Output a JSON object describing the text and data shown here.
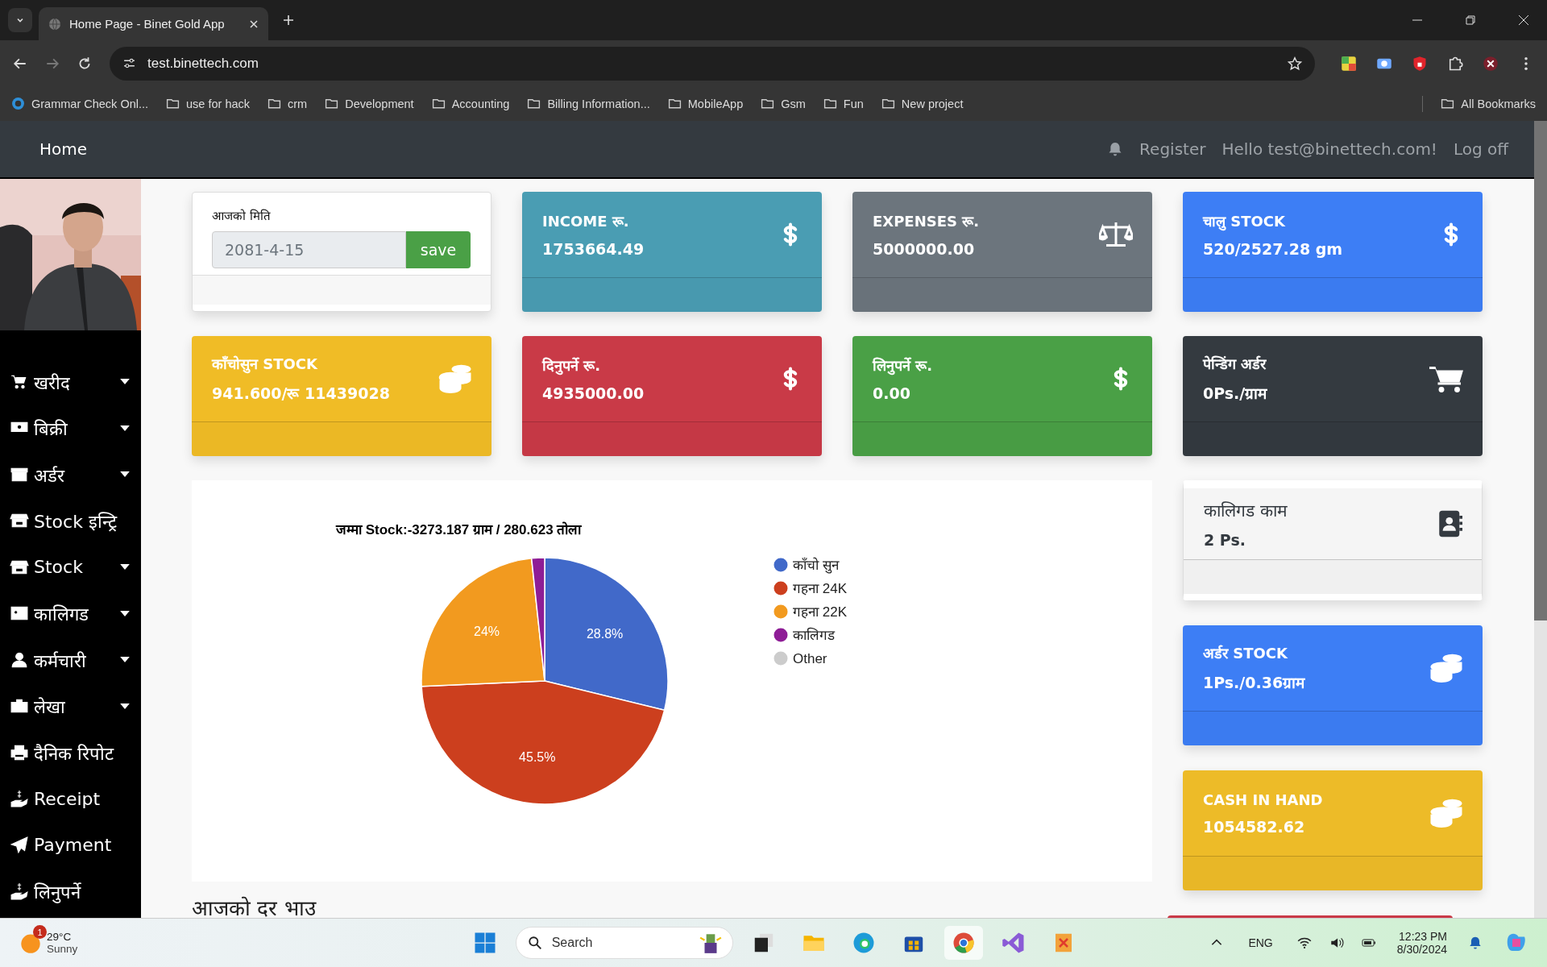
{
  "browser": {
    "tab_title": "Home Page - Binet Gold App",
    "url": "test.binettech.com",
    "bookmarks": [
      {
        "label": "Grammar Check Onl...",
        "kind": "site"
      },
      {
        "label": "use for hack",
        "kind": "folder"
      },
      {
        "label": "crm",
        "kind": "folder"
      },
      {
        "label": "Development",
        "kind": "folder"
      },
      {
        "label": "Accounting",
        "kind": "folder"
      },
      {
        "label": "Billing Information...",
        "kind": "folder"
      },
      {
        "label": "MobileApp",
        "kind": "folder"
      },
      {
        "label": "Gsm",
        "kind": "folder"
      },
      {
        "label": "Fun",
        "kind": "folder"
      },
      {
        "label": "New project",
        "kind": "folder"
      }
    ],
    "all_bookmarks": "All Bookmarks"
  },
  "navbar": {
    "brand": "Home",
    "links": [
      "Register",
      "Hello test@binettech.com!",
      "Log off"
    ]
  },
  "sidebar": {
    "items": [
      {
        "label": "खरीद",
        "kind": "dropdown"
      },
      {
        "label": "बिक्री",
        "kind": "dropdown"
      },
      {
        "label": "अर्डर",
        "kind": "dropdown"
      },
      {
        "label": "Stock इन्ट्रि",
        "kind": "link"
      },
      {
        "label": "Stock",
        "kind": "dropdown"
      },
      {
        "label": "कालिगड",
        "kind": "dropdown"
      },
      {
        "label": "कर्मचारी",
        "kind": "dropdown"
      },
      {
        "label": "लेखा",
        "kind": "dropdown"
      },
      {
        "label": "दैनिक रिपोट",
        "kind": "link"
      },
      {
        "label": "Receipt",
        "kind": "link"
      },
      {
        "label": "Payment",
        "kind": "link"
      },
      {
        "label": "लिनुपर्ने",
        "kind": "link"
      }
    ]
  },
  "date_card": {
    "label": "आजको मिति",
    "value": "2081-4-15",
    "button": "save"
  },
  "cards": [
    {
      "title": "INCOME रू.",
      "value": "1753664.49",
      "kind": "dollar",
      "color": "#4a9db3"
    },
    {
      "title": "EXPENSES रू.",
      "value": "5000000.00",
      "kind": "scale",
      "color": "#6c757d"
    },
    {
      "title": "चालु STOCK",
      "value": "520/2527.28 gm",
      "kind": "dollar",
      "color": "#3d7ef5"
    },
    {
      "title": "काँचोसुन STOCK",
      "value": "941.600/रू 11439028",
      "kind": "coins",
      "color": "#f0bc26"
    },
    {
      "title": "दिनुपर्ने रू.",
      "value": "4935000.00",
      "kind": "dollar",
      "color": "#c93a47"
    },
    {
      "title": "लिनुपर्ने रू.",
      "value": "0.00",
      "kind": "dollar",
      "color": "#4aa046"
    },
    {
      "title": "पेन्डिंग अर्डर",
      "value": "0Ps./ग्राम",
      "kind": "cart",
      "color": "#343a40"
    }
  ],
  "chart_data": {
    "type": "pie",
    "title": "जम्मा Stock:-3273.187 ग्राम / 280.623 तोला",
    "categories": [
      "काँचो सुन",
      "गहना 24K",
      "गहना 22K",
      "कालिगड",
      "Other"
    ],
    "values": [
      28.8,
      45.5,
      24,
      1.7,
      0
    ],
    "value_labels": [
      "28.8%",
      "45.5%",
      "24%",
      null,
      null
    ],
    "legend": "right"
  },
  "side_cards": [
    {
      "title": "कालिगड काम",
      "value": "2 Ps.",
      "kind": "contact",
      "color": "#f5f5f5"
    },
    {
      "title": "अर्डर STOCK",
      "value": "1Ps./0.36ग्राम",
      "kind": "coins",
      "color": "#3d7ef5"
    },
    {
      "title": "CASH IN HAND",
      "value": "1054582.62",
      "kind": "coins",
      "color": "#edbb28"
    }
  ],
  "section_heading": "आजको दर भाउ",
  "taskbar": {
    "temperature": "29°C",
    "weather": "Sunny",
    "weather_badge": "1",
    "search": "Search",
    "language": "ENG",
    "time": "12:23 PM",
    "date": "8/30/2024"
  }
}
